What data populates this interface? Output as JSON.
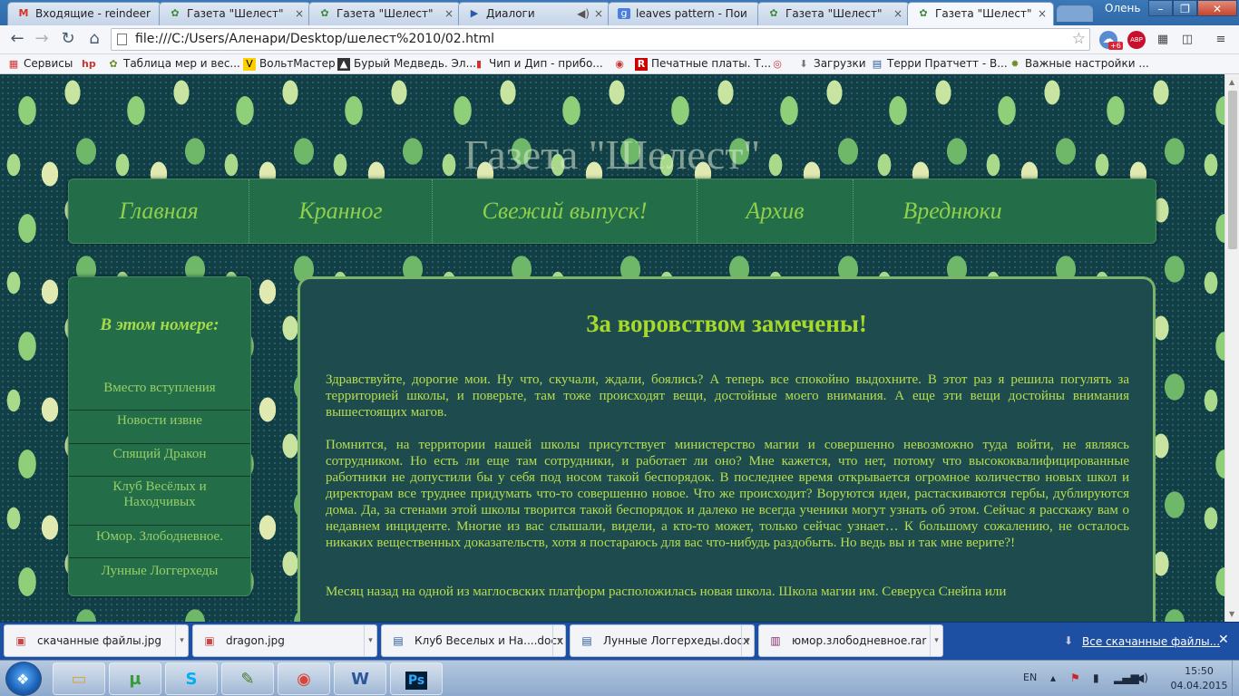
{
  "browser": {
    "tabs": [
      {
        "label": "Входящие - reindeer",
        "icon": "gmail-icon"
      },
      {
        "label": "Газета \"Шелест\"",
        "icon": "leaf-favicon"
      },
      {
        "label": "Газета \"Шелест\"",
        "icon": "leaf-favicon"
      },
      {
        "label": "Диалоги",
        "icon": "play-icon"
      },
      {
        "label": "leaves pattern - Пои",
        "icon": "google-icon"
      },
      {
        "label": "Газета \"Шелест\"",
        "icon": "leaf-favicon"
      },
      {
        "label": "Газета \"Шелест\"",
        "icon": "leaf-favicon"
      }
    ],
    "user": "Олень",
    "url": "file:///C:/Users/Аленари/Desktop/шелест%2010/02.html",
    "extension_badges": {
      "weather": "+6",
      "abp": "ABP"
    },
    "bookmarks": [
      "Сервисы",
      "Таблица мер и вес...",
      "ВольтМастер",
      "Бурый Медведь. Эл...",
      "Чип и Дип - прибо...",
      "Печатные платы. Т...",
      "Загрузки",
      "Терри Пратчетт - В...",
      "Важные настройки ..."
    ]
  },
  "page": {
    "site_title": "Газета \"Шелест\"",
    "nav": [
      "Главная",
      "Кранног",
      "Свежий выпуск!",
      "Архив",
      "Вреднюки"
    ],
    "sidebar": {
      "heading": "В этом номере:",
      "links": [
        "Вместо вступления",
        "Новости извне",
        "Спящий Дракон",
        "Клуб Весёлых и Находчивых",
        "Юмор. Злободневное.",
        "Лунные Логгерхеды"
      ]
    },
    "article": {
      "title": "За воровством замечены!",
      "paragraphs": [
        "Здравствуйте, дорогие мои. Ну что, скучали, ждали, боялись? А теперь все спокойно выдохните. В этот раз я решила погулять за территорией школы, и поверьте, там тоже происходят вещи, достойные моего внимания. А еще эти вещи достойны внимания вышестоящих магов.",
        "Помнится, на территории нашей школы присутствует министерство магии и совершенно невозможно туда войти, не являясь сотрудником. Но есть ли еще там сотрудники, и работает ли оно? Мне кажется, что нет, потому что высококвалифицированные работники не допустили бы у себя под носом такой беспорядок. В последнее время открывается огромное количество новых школ и директорам все труднее придумать что-то совершенно новое. Что же происходит? Воруются идеи, растаскиваются гербы, дублируются дома. Да, за стенами этой школы творится такой беспорядок и далеко не всегда ученики могут узнать об этом. Сейчас я расскажу вам о недавнем инциденте. Многие из вас слышали, видели, а кто-то может, только сейчас узнает… К большому сожалению, не осталось никаких вещественных доказательств, хотя я постараюсь для вас что-нибудь раздобыть. Но ведь вы и так мне верите?!",
        "Месяц назад на одной из маглосвских платформ расположилась новая школа. Школа магии им. Северуса Снейпа или"
      ]
    }
  },
  "downloads": {
    "items": [
      {
        "name": "скачанные файлы.jpg",
        "icon": "image-file-icon"
      },
      {
        "name": "dragon.jpg",
        "icon": "image-file-icon"
      },
      {
        "name": "Клуб Веселых и На....docx",
        "icon": "word-file-icon"
      },
      {
        "name": "Лунные Логгерхеды.docx",
        "icon": "word-file-icon"
      },
      {
        "name": "юмор.злободневное.rar",
        "icon": "archive-file-icon"
      }
    ],
    "show_all": "Все скачанные файлы..."
  },
  "taskbar": {
    "apps": [
      "explorer",
      "utorrent",
      "skype",
      "notepad",
      "chrome",
      "word",
      "photoshop"
    ],
    "language": "EN",
    "time": "15:50",
    "date": "04.04.2015"
  }
}
